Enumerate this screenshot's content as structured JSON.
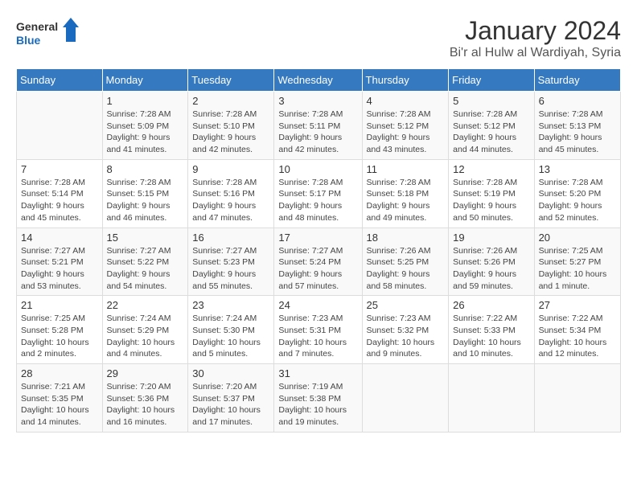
{
  "header": {
    "logo_general": "General",
    "logo_blue": "Blue",
    "month_year": "January 2024",
    "location": "Bi'r al Hulw al Wardiyah, Syria"
  },
  "days_of_week": [
    "Sunday",
    "Monday",
    "Tuesday",
    "Wednesday",
    "Thursday",
    "Friday",
    "Saturday"
  ],
  "weeks": [
    [
      {
        "day": "",
        "info": ""
      },
      {
        "day": "1",
        "info": "Sunrise: 7:28 AM\nSunset: 5:09 PM\nDaylight: 9 hours\nand 41 minutes."
      },
      {
        "day": "2",
        "info": "Sunrise: 7:28 AM\nSunset: 5:10 PM\nDaylight: 9 hours\nand 42 minutes."
      },
      {
        "day": "3",
        "info": "Sunrise: 7:28 AM\nSunset: 5:11 PM\nDaylight: 9 hours\nand 42 minutes."
      },
      {
        "day": "4",
        "info": "Sunrise: 7:28 AM\nSunset: 5:12 PM\nDaylight: 9 hours\nand 43 minutes."
      },
      {
        "day": "5",
        "info": "Sunrise: 7:28 AM\nSunset: 5:12 PM\nDaylight: 9 hours\nand 44 minutes."
      },
      {
        "day": "6",
        "info": "Sunrise: 7:28 AM\nSunset: 5:13 PM\nDaylight: 9 hours\nand 45 minutes."
      }
    ],
    [
      {
        "day": "7",
        "info": "Sunrise: 7:28 AM\nSunset: 5:14 PM\nDaylight: 9 hours\nand 45 minutes."
      },
      {
        "day": "8",
        "info": "Sunrise: 7:28 AM\nSunset: 5:15 PM\nDaylight: 9 hours\nand 46 minutes."
      },
      {
        "day": "9",
        "info": "Sunrise: 7:28 AM\nSunset: 5:16 PM\nDaylight: 9 hours\nand 47 minutes."
      },
      {
        "day": "10",
        "info": "Sunrise: 7:28 AM\nSunset: 5:17 PM\nDaylight: 9 hours\nand 48 minutes."
      },
      {
        "day": "11",
        "info": "Sunrise: 7:28 AM\nSunset: 5:18 PM\nDaylight: 9 hours\nand 49 minutes."
      },
      {
        "day": "12",
        "info": "Sunrise: 7:28 AM\nSunset: 5:19 PM\nDaylight: 9 hours\nand 50 minutes."
      },
      {
        "day": "13",
        "info": "Sunrise: 7:28 AM\nSunset: 5:20 PM\nDaylight: 9 hours\nand 52 minutes."
      }
    ],
    [
      {
        "day": "14",
        "info": "Sunrise: 7:27 AM\nSunset: 5:21 PM\nDaylight: 9 hours\nand 53 minutes."
      },
      {
        "day": "15",
        "info": "Sunrise: 7:27 AM\nSunset: 5:22 PM\nDaylight: 9 hours\nand 54 minutes."
      },
      {
        "day": "16",
        "info": "Sunrise: 7:27 AM\nSunset: 5:23 PM\nDaylight: 9 hours\nand 55 minutes."
      },
      {
        "day": "17",
        "info": "Sunrise: 7:27 AM\nSunset: 5:24 PM\nDaylight: 9 hours\nand 57 minutes."
      },
      {
        "day": "18",
        "info": "Sunrise: 7:26 AM\nSunset: 5:25 PM\nDaylight: 9 hours\nand 58 minutes."
      },
      {
        "day": "19",
        "info": "Sunrise: 7:26 AM\nSunset: 5:26 PM\nDaylight: 9 hours\nand 59 minutes."
      },
      {
        "day": "20",
        "info": "Sunrise: 7:25 AM\nSunset: 5:27 PM\nDaylight: 10 hours\nand 1 minute."
      }
    ],
    [
      {
        "day": "21",
        "info": "Sunrise: 7:25 AM\nSunset: 5:28 PM\nDaylight: 10 hours\nand 2 minutes."
      },
      {
        "day": "22",
        "info": "Sunrise: 7:24 AM\nSunset: 5:29 PM\nDaylight: 10 hours\nand 4 minutes."
      },
      {
        "day": "23",
        "info": "Sunrise: 7:24 AM\nSunset: 5:30 PM\nDaylight: 10 hours\nand 5 minutes."
      },
      {
        "day": "24",
        "info": "Sunrise: 7:23 AM\nSunset: 5:31 PM\nDaylight: 10 hours\nand 7 minutes."
      },
      {
        "day": "25",
        "info": "Sunrise: 7:23 AM\nSunset: 5:32 PM\nDaylight: 10 hours\nand 9 minutes."
      },
      {
        "day": "26",
        "info": "Sunrise: 7:22 AM\nSunset: 5:33 PM\nDaylight: 10 hours\nand 10 minutes."
      },
      {
        "day": "27",
        "info": "Sunrise: 7:22 AM\nSunset: 5:34 PM\nDaylight: 10 hours\nand 12 minutes."
      }
    ],
    [
      {
        "day": "28",
        "info": "Sunrise: 7:21 AM\nSunset: 5:35 PM\nDaylight: 10 hours\nand 14 minutes."
      },
      {
        "day": "29",
        "info": "Sunrise: 7:20 AM\nSunset: 5:36 PM\nDaylight: 10 hours\nand 16 minutes."
      },
      {
        "day": "30",
        "info": "Sunrise: 7:20 AM\nSunset: 5:37 PM\nDaylight: 10 hours\nand 17 minutes."
      },
      {
        "day": "31",
        "info": "Sunrise: 7:19 AM\nSunset: 5:38 PM\nDaylight: 10 hours\nand 19 minutes."
      },
      {
        "day": "",
        "info": ""
      },
      {
        "day": "",
        "info": ""
      },
      {
        "day": "",
        "info": ""
      }
    ]
  ]
}
